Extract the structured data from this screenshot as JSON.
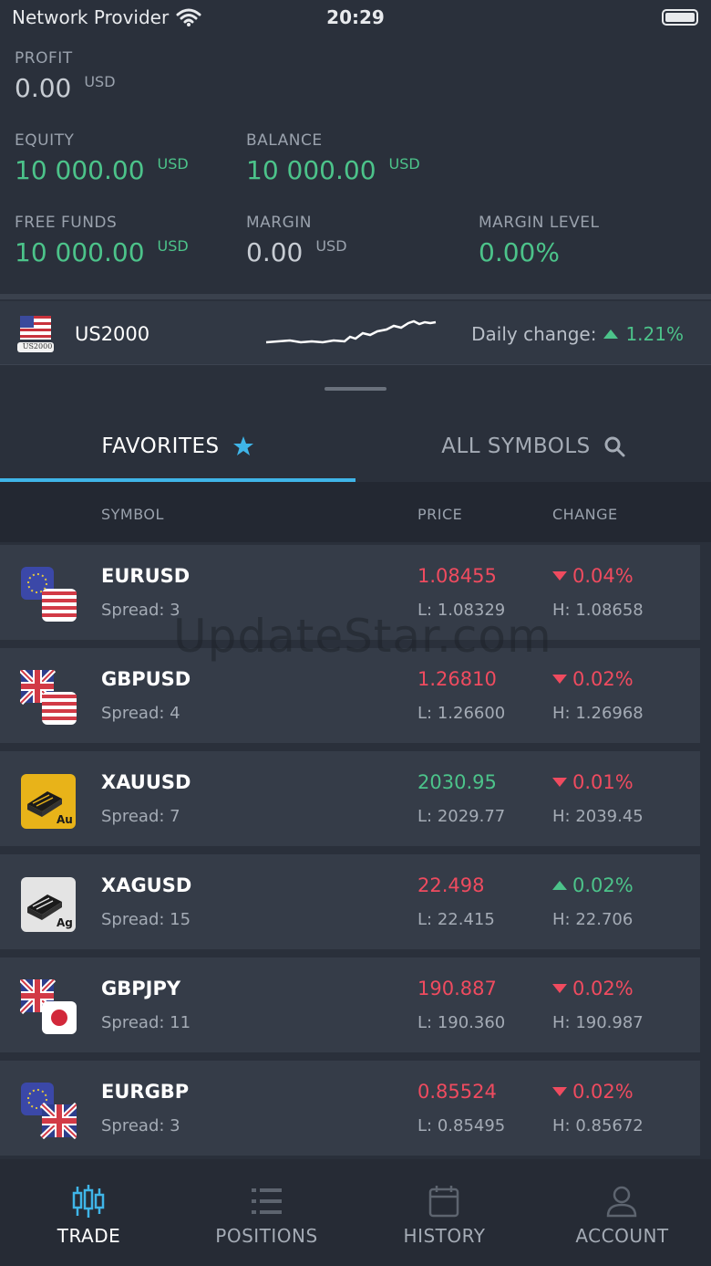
{
  "status_bar": {
    "carrier": "Network Provider",
    "time": "20:29"
  },
  "account": {
    "profit": {
      "label": "PROFIT",
      "value": "0.00",
      "unit": "USD"
    },
    "equity": {
      "label": "EQUITY",
      "value": "10 000.00",
      "unit": "USD"
    },
    "balance": {
      "label": "BALANCE",
      "value": "10 000.00",
      "unit": "USD"
    },
    "free_funds": {
      "label": "FREE FUNDS",
      "value": "10 000.00",
      "unit": "USD"
    },
    "margin": {
      "label": "MARGIN",
      "value": "0.00",
      "unit": "USD"
    },
    "margin_level": {
      "label": "MARGIN LEVEL",
      "value": "0.00%"
    }
  },
  "ticker": {
    "symbol": "US2000",
    "flag_caption": "US2000",
    "daily_change_label": "Daily change:",
    "daily_change": "1.21%"
  },
  "tabs": {
    "favorites": "FAVORITES",
    "all_symbols": "ALL SYMBOLS"
  },
  "table": {
    "headers": {
      "symbol": "SYMBOL",
      "price": "PRICE",
      "change": "CHANGE"
    },
    "rows": [
      {
        "symbol": "EURUSD",
        "spread": "Spread: 3",
        "price": "1.08455",
        "low": "L: 1.08329",
        "change": "0.04%",
        "high": "H: 1.08658",
        "price_dir": "down",
        "change_dir": "down",
        "icon": "eur-usd-flags-icon"
      },
      {
        "symbol": "GBPUSD",
        "spread": "Spread: 4",
        "price": "1.26810",
        "low": "L: 1.26600",
        "change": "0.02%",
        "high": "H: 1.26968",
        "price_dir": "down",
        "change_dir": "down",
        "icon": "gbp-usd-flags-icon"
      },
      {
        "symbol": "XAUUSD",
        "spread": "Spread: 7",
        "price": "2030.95",
        "low": "L: 2029.77",
        "change": "0.01%",
        "high": "H: 2039.45",
        "price_dir": "up",
        "change_dir": "down",
        "icon": "gold-bar-icon"
      },
      {
        "symbol": "XAGUSD",
        "spread": "Spread: 15",
        "price": "22.498",
        "low": "L: 22.415",
        "change": "0.02%",
        "high": "H: 22.706",
        "price_dir": "down",
        "change_dir": "up",
        "icon": "silver-bar-icon"
      },
      {
        "symbol": "GBPJPY",
        "spread": "Spread: 11",
        "price": "190.887",
        "low": "L: 190.360",
        "change": "0.02%",
        "high": "H: 190.987",
        "price_dir": "down",
        "change_dir": "down",
        "icon": "gbp-jpy-flags-icon"
      },
      {
        "symbol": "EURGBP",
        "spread": "Spread: 3",
        "price": "0.85524",
        "low": "L: 0.85495",
        "change": "0.02%",
        "high": "H: 0.85672",
        "price_dir": "down",
        "change_dir": "down",
        "icon": "eur-gbp-flags-icon"
      }
    ]
  },
  "nav": {
    "trade": "TRADE",
    "positions": "POSITIONS",
    "history": "HISTORY",
    "account": "ACCOUNT"
  },
  "watermark": "UpdateStar.com",
  "colors": {
    "background": "#2a303b",
    "accent": "#3fb5e8",
    "up": "#4cc38a",
    "down": "#ef4b5f"
  }
}
